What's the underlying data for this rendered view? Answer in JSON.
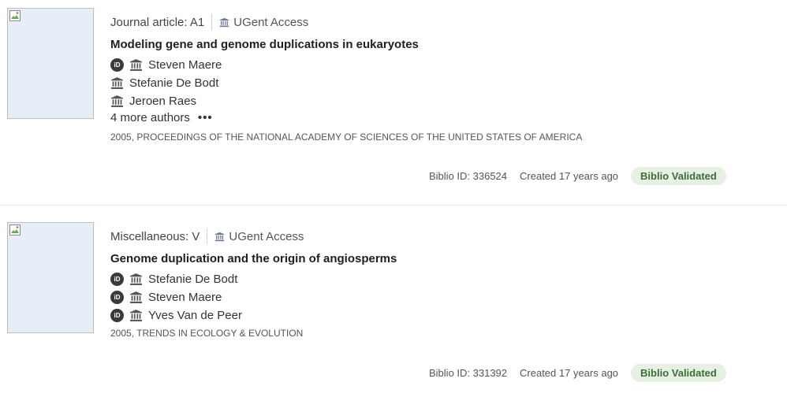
{
  "records": [
    {
      "type": "Journal article: A1",
      "access": "UGent Access",
      "title": "Modeling gene and genome duplications in eukaryotes",
      "authors": [
        {
          "name": "Steven Maere",
          "orcid": true
        },
        {
          "name": "Stefanie De Bodt",
          "orcid": false
        },
        {
          "name": "Jeroen Raes",
          "orcid": false
        }
      ],
      "more_authors": "4 more authors",
      "more_dots": "•••",
      "pub_info": "2005, PROCEEDINGS OF THE NATIONAL ACADEMY OF SCIENCES OF THE UNITED STATES OF AMERICA",
      "biblio_id": "Biblio ID: 336524",
      "created": "Created 17 years ago",
      "status": "Biblio Validated"
    },
    {
      "type": "Miscellaneous: V",
      "access": "UGent Access",
      "title": "Genome duplication and the origin of angiosperms",
      "authors": [
        {
          "name": "Stefanie De Bodt",
          "orcid": true
        },
        {
          "name": "Steven Maere",
          "orcid": true
        },
        {
          "name": "Yves Van de Peer",
          "orcid": true
        }
      ],
      "pub_info": "2005, TRENDS IN ECOLOGY & EVOLUTION",
      "biblio_id": "Biblio ID: 331392",
      "created": "Created 17 years ago",
      "status": "Biblio Validated"
    }
  ],
  "icons": {
    "orcid": "iD",
    "institution": "institution-icon"
  },
  "colors": {
    "badge_bg": "#e6f1e4",
    "badge_text": "#3f6b3a",
    "thumb_bg": "#e8eef8"
  }
}
